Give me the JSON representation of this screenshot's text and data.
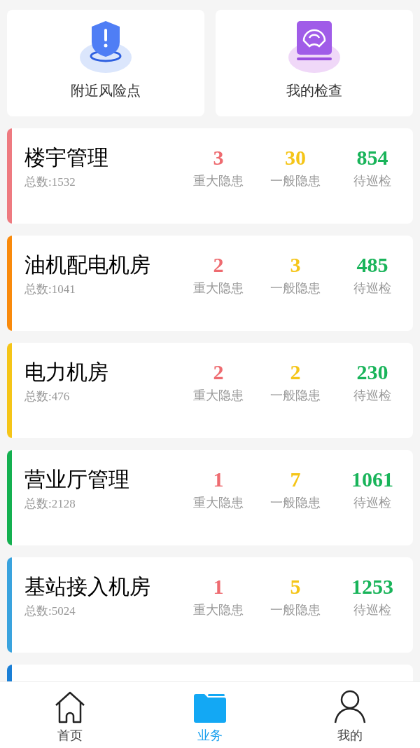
{
  "shortcuts": [
    {
      "label": "附近风险点",
      "kind": "risk"
    },
    {
      "label": "我的检查",
      "kind": "inspect"
    }
  ],
  "categories": [
    {
      "name": "楼宇管理",
      "total": "总数:1532",
      "color": "#ee7a80",
      "stats": [
        {
          "value": "3",
          "label": "重大隐患",
          "kind": "major"
        },
        {
          "value": "30",
          "label": "一般隐患",
          "kind": "general"
        },
        {
          "value": "854",
          "label": "待巡检",
          "kind": "pending"
        }
      ]
    },
    {
      "name": "油机配电机房",
      "total": "总数:1041",
      "color": "#f98a0c",
      "stats": [
        {
          "value": "2",
          "label": "重大隐患",
          "kind": "major"
        },
        {
          "value": "3",
          "label": "一般隐患",
          "kind": "general"
        },
        {
          "value": "485",
          "label": "待巡检",
          "kind": "pending"
        }
      ]
    },
    {
      "name": "电力机房",
      "total": "总数:476",
      "color": "#f5c518",
      "stats": [
        {
          "value": "2",
          "label": "重大隐患",
          "kind": "major"
        },
        {
          "value": "2",
          "label": "一般隐患",
          "kind": "general"
        },
        {
          "value": "230",
          "label": "待巡检",
          "kind": "pending"
        }
      ]
    },
    {
      "name": "营业厅管理",
      "total": "总数:2128",
      "color": "#14b050",
      "stats": [
        {
          "value": "1",
          "label": "重大隐患",
          "kind": "major"
        },
        {
          "value": "7",
          "label": "一般隐患",
          "kind": "general"
        },
        {
          "value": "1061",
          "label": "待巡检",
          "kind": "pending"
        }
      ]
    },
    {
      "name": "基站接入机房",
      "total": "总数:5024",
      "color": "#3aa3de",
      "stats": [
        {
          "value": "1",
          "label": "重大隐患",
          "kind": "major"
        },
        {
          "value": "5",
          "label": "一般隐患",
          "kind": "general"
        },
        {
          "value": "1253",
          "label": "待巡检",
          "kind": "pending"
        }
      ]
    }
  ],
  "partial_card": {
    "color": "#1a7fd6"
  },
  "tabs": [
    {
      "label": "首页",
      "kind": "home",
      "selected": false
    },
    {
      "label": "业务",
      "kind": "business",
      "selected": true
    },
    {
      "label": "我的",
      "kind": "me",
      "selected": false
    }
  ]
}
